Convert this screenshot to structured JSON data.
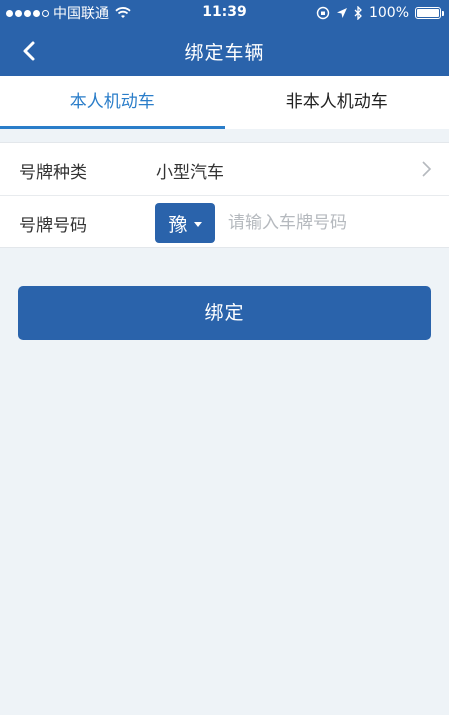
{
  "status_bar": {
    "carrier": "中国联通",
    "time": "11:39",
    "battery": "100%",
    "battery_level": 1.0,
    "signal_bars": 4
  },
  "navbar": {
    "title": "绑定车辆",
    "back_icon": "chevron-left-icon"
  },
  "tabs": [
    {
      "label": "本人机动车",
      "active": true
    },
    {
      "label": "非本人机动车",
      "active": false
    }
  ],
  "form": {
    "plate_type": {
      "label": "号牌种类",
      "value": "小型汽车"
    },
    "plate_number": {
      "label": "号牌号码",
      "province": "豫",
      "placeholder": "请输入车牌号码",
      "value": ""
    }
  },
  "bind_button": {
    "label": "绑定"
  },
  "colors": {
    "primary": "#2a63ab",
    "tab_active": "#2a7dc9",
    "background": "#eef3f7"
  }
}
